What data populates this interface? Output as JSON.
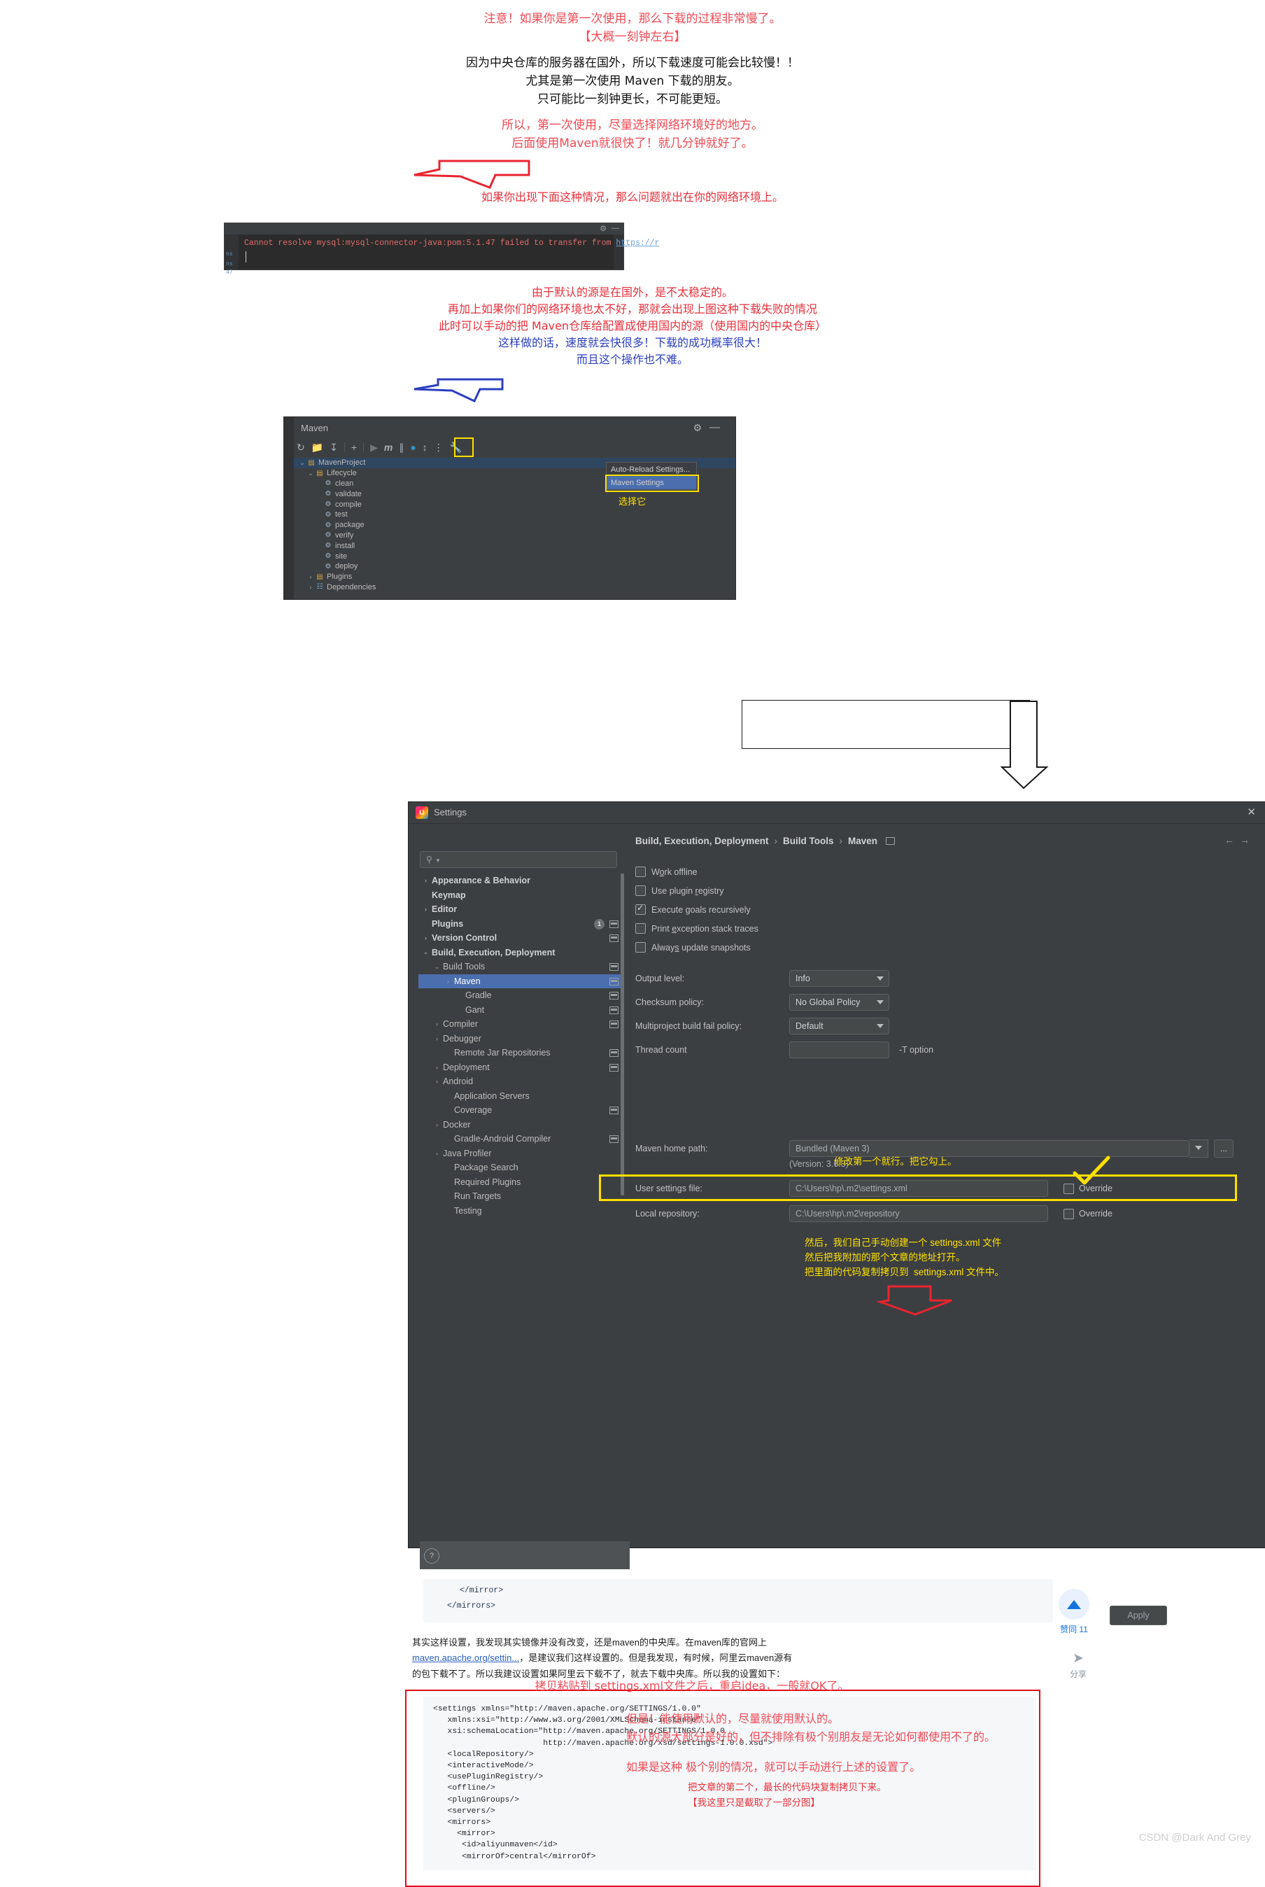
{
  "intro": {
    "lines": [
      {
        "text": "注意！如果你是第一次使用，那么下载的过程非常慢了。",
        "style": "warn"
      },
      {
        "text": "【大概一刻钟左右】",
        "style": "warn"
      },
      {
        "text": "因为中央仓库的服务器在国外，所以下载速度可能会比较慢！！",
        "style": "body"
      },
      {
        "text": "尤其是第一次使用 Maven 下载的朋友。",
        "style": "body"
      },
      {
        "text": "只可能比一刻钟更长，不可能更短。",
        "style": "body"
      },
      {
        "text": "所以，第一次使用，尽量选择网络环境好的地方。",
        "style": "adv"
      },
      {
        "text": "后面使用Maven就很快了！就几分钟就好了。",
        "style": "adv"
      }
    ],
    "arrow_caption": "如果你出现下面这种情况，那么问题就出在你的网络环境上。"
  },
  "terminal": {
    "error_prefix": "Cannot resolve mysql:mysql-connector-java:pom:5.1.47 failed to transfer from ",
    "error_link": "https://r",
    "gutter_left_1": "ns",
    "gutter_left_2": "ns",
    "gutter_left_3": "47",
    "gear_icon": "gear-icon",
    "minimize_icon": "minimize-icon"
  },
  "mid": {
    "lines": [
      {
        "text": "由于默认的源是在国外，是不太稳定的。",
        "color": "red"
      },
      {
        "text": "再加上如果你们的网络环境也太不好，那就会出现上图这种下载失败的情况",
        "color": "red"
      },
      {
        "text": "此时可以手动的把 Maven仓库给配置成使用国内的源（使用国内的中央仓库）",
        "color": "red"
      },
      {
        "text": "这样做的话，速度就会快很多！下载的成功概率很大！",
        "color": "blue"
      },
      {
        "text": "而且这个操作也不难。",
        "color": "blue"
      }
    ]
  },
  "maven_panel": {
    "title": "Maven",
    "toolbar_icons": [
      "reload-icon",
      "add-folder-icon",
      "download-sources-icon",
      "plus-icon",
      "run-icon",
      "m-icon",
      "skip-tests-icon",
      "execute-icon",
      "expand-icon",
      "collapse-icon",
      "wrench-icon"
    ],
    "gear_icon": "gear-icon",
    "minimize_icon": "minimize-icon",
    "tree": [
      {
        "label": "MavenProject",
        "depth": 0,
        "twist": "v",
        "icon": "maven-project-icon",
        "selected": true
      },
      {
        "label": "Lifecycle",
        "depth": 1,
        "twist": "v",
        "icon": "lifecycle-folder-icon",
        "selected": false
      },
      {
        "label": "clean",
        "depth": 2,
        "twist": "",
        "icon": "goal-gear-icon",
        "selected": false
      },
      {
        "label": "validate",
        "depth": 2,
        "twist": "",
        "icon": "goal-gear-icon",
        "selected": false
      },
      {
        "label": "compile",
        "depth": 2,
        "twist": "",
        "icon": "goal-gear-icon",
        "selected": false
      },
      {
        "label": "test",
        "depth": 2,
        "twist": "",
        "icon": "goal-gear-icon",
        "selected": false
      },
      {
        "label": "package",
        "depth": 2,
        "twist": "",
        "icon": "goal-gear-icon",
        "selected": false
      },
      {
        "label": "verify",
        "depth": 2,
        "twist": "",
        "icon": "goal-gear-icon",
        "selected": false
      },
      {
        "label": "install",
        "depth": 2,
        "twist": "",
        "icon": "goal-gear-icon",
        "selected": false
      },
      {
        "label": "site",
        "depth": 2,
        "twist": "",
        "icon": "goal-gear-icon",
        "selected": false
      },
      {
        "label": "deploy",
        "depth": 2,
        "twist": "",
        "icon": "goal-gear-icon",
        "selected": false
      },
      {
        "label": "Plugins",
        "depth": 1,
        "twist": ">",
        "icon": "plugins-folder-icon",
        "selected": false
      },
      {
        "label": "Dependencies",
        "depth": 1,
        "twist": ">",
        "icon": "dependencies-icon",
        "selected": false
      }
    ],
    "menu": [
      {
        "label": "Auto-Reload Settings...",
        "highlighted": false
      },
      {
        "label": "Maven Settings",
        "highlighted": true
      }
    ],
    "pick_label": "选择它"
  },
  "settings": {
    "window_title": "Settings",
    "close_icon": "close-icon",
    "search_placeholder": "",
    "sidebar": [
      {
        "label": "Appearance & Behavior",
        "depth": 0,
        "twist": ">",
        "bold": true,
        "selected": false,
        "badge": "",
        "square": false
      },
      {
        "label": "Keymap",
        "depth": 0,
        "twist": "",
        "bold": true,
        "selected": false,
        "badge": "",
        "square": false
      },
      {
        "label": "Editor",
        "depth": 0,
        "twist": ">",
        "bold": true,
        "selected": false,
        "badge": "",
        "square": false
      },
      {
        "label": "Plugins",
        "depth": 0,
        "twist": "",
        "bold": true,
        "selected": false,
        "badge": "1",
        "square": true
      },
      {
        "label": "Version Control",
        "depth": 0,
        "twist": ">",
        "bold": true,
        "selected": false,
        "badge": "",
        "square": true
      },
      {
        "label": "Build, Execution, Deployment",
        "depth": 0,
        "twist": "v",
        "bold": true,
        "selected": false,
        "badge": "",
        "square": false
      },
      {
        "label": "Build Tools",
        "depth": 1,
        "twist": "v",
        "bold": false,
        "selected": false,
        "badge": "",
        "square": true
      },
      {
        "label": "Maven",
        "depth": 2,
        "twist": ">",
        "bold": false,
        "selected": true,
        "badge": "",
        "square": true
      },
      {
        "label": "Gradle",
        "depth": 3,
        "twist": "",
        "bold": false,
        "selected": false,
        "badge": "",
        "square": true
      },
      {
        "label": "Gant",
        "depth": 3,
        "twist": "",
        "bold": false,
        "selected": false,
        "badge": "",
        "square": true
      },
      {
        "label": "Compiler",
        "depth": 1,
        "twist": ">",
        "bold": false,
        "selected": false,
        "badge": "",
        "square": true
      },
      {
        "label": "Debugger",
        "depth": 1,
        "twist": ">",
        "bold": false,
        "selected": false,
        "badge": "",
        "square": false
      },
      {
        "label": "Remote Jar Repositories",
        "depth": 2,
        "twist": "",
        "bold": false,
        "selected": false,
        "badge": "",
        "square": true
      },
      {
        "label": "Deployment",
        "depth": 1,
        "twist": ">",
        "bold": false,
        "selected": false,
        "badge": "",
        "square": true
      },
      {
        "label": "Android",
        "depth": 1,
        "twist": ">",
        "bold": false,
        "selected": false,
        "badge": "",
        "square": false
      },
      {
        "label": "Application Servers",
        "depth": 2,
        "twist": "",
        "bold": false,
        "selected": false,
        "badge": "",
        "square": false
      },
      {
        "label": "Coverage",
        "depth": 2,
        "twist": "",
        "bold": false,
        "selected": false,
        "badge": "",
        "square": true
      },
      {
        "label": "Docker",
        "depth": 1,
        "twist": ">",
        "bold": false,
        "selected": false,
        "badge": "",
        "square": false
      },
      {
        "label": "Gradle-Android Compiler",
        "depth": 2,
        "twist": "",
        "bold": false,
        "selected": false,
        "badge": "",
        "square": true
      },
      {
        "label": "Java Profiler",
        "depth": 1,
        "twist": ">",
        "bold": false,
        "selected": false,
        "badge": "",
        "square": false
      },
      {
        "label": "Package Search",
        "depth": 2,
        "twist": "",
        "bold": false,
        "selected": false,
        "badge": "",
        "square": false
      },
      {
        "label": "Required Plugins",
        "depth": 2,
        "twist": "",
        "bold": false,
        "selected": false,
        "badge": "",
        "square": false
      },
      {
        "label": "Run Targets",
        "depth": 2,
        "twist": "",
        "bold": false,
        "selected": false,
        "badge": "",
        "square": false
      },
      {
        "label": "Testing",
        "depth": 2,
        "twist": "",
        "bold": false,
        "selected": false,
        "badge": "",
        "square": false
      }
    ],
    "help_icon": "help-icon",
    "breadcrumb": [
      "Build, Execution, Deployment",
      "Build Tools",
      "Maven"
    ],
    "breadcrumb_sep": "›",
    "checkboxes": [
      {
        "label": "Work offline",
        "checked": false,
        "mnemonic": "o"
      },
      {
        "label": "Use plugin registry",
        "checked": false,
        "mnemonic": "r"
      },
      {
        "label": "Execute goals recursively",
        "checked": true,
        "mnemonic": "g"
      },
      {
        "label": "Print exception stack traces",
        "checked": false,
        "mnemonic": "e"
      },
      {
        "label": "Always update snapshots",
        "checked": false,
        "mnemonic": "s"
      }
    ],
    "fields": [
      {
        "label": "Output level:",
        "value": "Info",
        "type": "combo"
      },
      {
        "label": "Checksum policy:",
        "value": "No Global Policy",
        "type": "combo"
      },
      {
        "label": "Multiproject build fail policy:",
        "value": "Default",
        "type": "combo"
      },
      {
        "label": "Thread count",
        "value": "",
        "type": "text",
        "suffix": "-T option"
      }
    ],
    "maven_home_label": "Maven home path:",
    "maven_home_value": "Bundled (Maven 3)",
    "maven_version": "(Version: 3.6.3)",
    "user_settings_label": "User settings file:",
    "user_settings_value": "C:\\Users\\hp\\.m2\\settings.xml",
    "local_repo_label": "Local repository:",
    "local_repo_value": "C:\\Users\\hp\\.m2\\repository",
    "override_label": "Override",
    "dots_button": "...",
    "apply_button": "Apply",
    "annotation_yellow_1": "修改第一个就行。把它勾上。",
    "annotation_yellow_2": [
      "然后，我们自己手动创建一个 settings.xml 文件",
      "然后把我附加的那个文章的地址打开。",
      "把里面的代码复制拷贝到  settings.xml 文件中。"
    ]
  },
  "blog": {
    "code_top": [
      "</mirror>",
      "</mirrors>"
    ],
    "paragraph_1": "其实这样设置，我发现其实镜像并没有改变，还是maven的中央库。在maven库的官网上",
    "paragraph_link": "maven.apache.org/settin...",
    "paragraph_2": "，是建议我们这样设置的。但是我发现，有时候，阿里云maven源有",
    "paragraph_3": "的包下载不了。所以我建议设置如果阿里云下载不了，就去下载中央库。所以我的设置如下：",
    "code_lines": [
      "<settings xmlns=\"http://maven.apache.org/SETTINGS/1.0.0\"",
      "   xmlns:xsi=\"http://www.w3.org/2001/XMLSchema-instance\"",
      "   xsi:schemaLocation=\"http://maven.apache.org/SETTINGS/1.0.0",
      "                       http://maven.apache.org/xsd/settings-1.0.0.xsd\">",
      "   <localRepository/>",
      "   <interactiveMode/>",
      "   <usePluginRegistry/>",
      "   <offline/>",
      "   <pluginGroups/>",
      "   <servers/>",
      "   <mirrors>",
      "     <mirror>",
      "      <id>aliyunmaven</id>",
      "      <mirrorOf>central</mirrorOf>"
    ],
    "code_annotation": [
      "把文章的第二个，最长的代码块复制拷贝下来。",
      "【我这里只是截取了一部分图】"
    ],
    "vote_label": "赞同 11",
    "vote_icon": "upvote-triangle-icon",
    "share_label": "分享",
    "share_icon": "share-paper-plane-icon"
  },
  "bottom": {
    "center_line": "拷贝粘贴到 settings.xml文件之后，重启idea，一般就OK了。",
    "lines": [
      "但是！能使用默认的，尽量就使用默认的。",
      "默认的源大部分是好的，但不排除有极个别朋友是无论如何都使用不了的。",
      "如果是这种 极个别的情况，就可以手动进行上述的设置了。"
    ]
  },
  "watermark": "CSDN @Dark And Grey",
  "colors": {
    "annotation_red": "#f04a55",
    "annotation_blue": "#2b3fbf",
    "highlight_yellow": "#ffe000",
    "ide_bg": "#3c3f41",
    "selection_blue": "#4b6eaf"
  }
}
